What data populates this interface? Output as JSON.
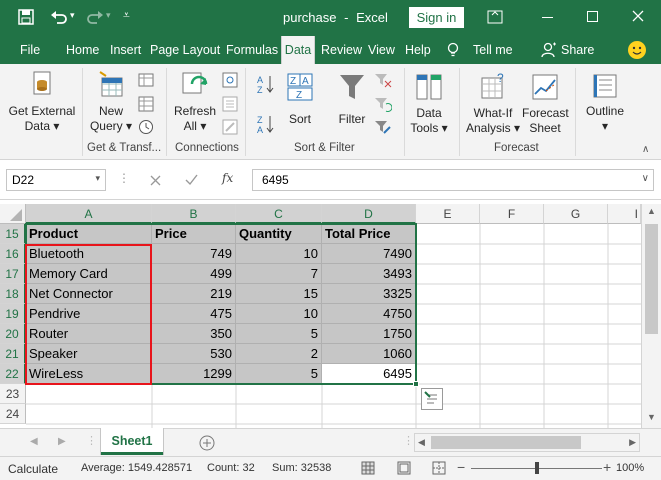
{
  "title": {
    "doc": "purchase",
    "sep": "-",
    "app": "Excel",
    "signin": "Sign in"
  },
  "tabs": [
    "File",
    "Home",
    "Insert",
    "Page Layout",
    "Formulas",
    "Data",
    "Review",
    "View",
    "Help",
    "Tell me",
    "Share"
  ],
  "ribbon": {
    "get_external": [
      "Get External",
      "Data"
    ],
    "new_query": [
      "New",
      "Query"
    ],
    "refresh": [
      "Refresh",
      "All"
    ],
    "sort": "Sort",
    "filter": "Filter",
    "data_tools": [
      "Data",
      "Tools"
    ],
    "whatif": [
      "What-If",
      "Analysis"
    ],
    "forecast": [
      "Forecast",
      "Sheet"
    ],
    "outline": "Outline",
    "groups": [
      "Get & Transf...",
      "Connections",
      "Sort & Filter",
      "Forecast"
    ]
  },
  "formula_bar": {
    "name_box": "D22",
    "fx": "fx",
    "value": "6495"
  },
  "columns": [
    "A",
    "B",
    "C",
    "D",
    "E",
    "F",
    "G",
    "I"
  ],
  "rows": [
    "15",
    "16",
    "17",
    "18",
    "19",
    "20",
    "21",
    "22",
    "23",
    "24"
  ],
  "table": {
    "headers": [
      "Product",
      "Price",
      "Quantity",
      "Total Price"
    ],
    "data": [
      [
        "Bluetooth",
        "749",
        "10",
        "7490"
      ],
      [
        "Memory Card",
        "499",
        "7",
        "3493"
      ],
      [
        "Net Connector",
        "219",
        "15",
        "3325"
      ],
      [
        "Pendrive",
        "475",
        "10",
        "4750"
      ],
      [
        "Router",
        "350",
        "5",
        "1750"
      ],
      [
        "Speaker",
        "530",
        "2",
        "1060"
      ],
      [
        "WireLess",
        "1299",
        "5",
        "6495"
      ]
    ]
  },
  "sheet": {
    "tab": "Sheet1"
  },
  "status": {
    "mode": "Calculate",
    "average": "Average: 1549.428571",
    "count": "Count: 32",
    "sum": "Sum: 32538",
    "zoom": "100%"
  },
  "colors": {
    "accent": "#217346",
    "selection_shade": "#c6c6c6",
    "highlight": "#e8141b"
  }
}
